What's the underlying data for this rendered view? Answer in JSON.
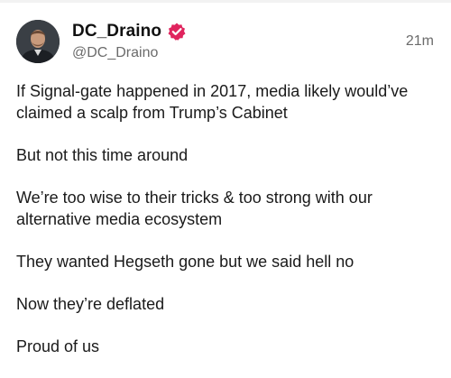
{
  "author": {
    "display_name": "DC_Draino",
    "handle": "@DC_Draino",
    "verified": true,
    "verified_color": "#e0245e"
  },
  "post": {
    "timestamp": "21m",
    "paragraphs": [
      "If Signal-gate happened in 2017, media likely would’ve claimed a scalp from Trump’s Cabinet",
      "But not this time around",
      "We’re too wise to their tricks & too strong with our alternative media ecosystem",
      "They wanted Hegseth gone but we said hell no",
      "Now they’re deflated",
      "Proud of us"
    ]
  },
  "icons": {
    "avatar": "avatar-icon",
    "verified": "verified-badge-icon"
  }
}
